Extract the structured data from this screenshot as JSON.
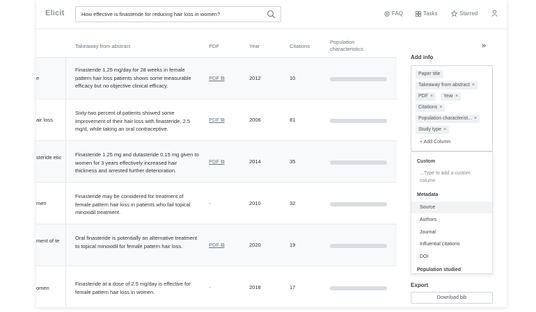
{
  "header": {
    "logo": "Elicit",
    "search_value": "How effective is finasteride for reducing hair loss in women?",
    "nav": {
      "faq": "FAQ",
      "tasks": "Tasks",
      "starred": "Starred"
    }
  },
  "table": {
    "columns": [
      "Takeaway from abstract",
      "PDF",
      "Year",
      "Citations",
      "Population",
      "characteristics"
    ],
    "rows": [
      {
        "left": "e",
        "takeaway": "Finasteride 1.25 mg/day for 28 weeks in female pattern hair loss patients shows some measurable efficacy but no objective clinical efficacy.",
        "pdf": "PDF",
        "year": "2012",
        "citations": "10"
      },
      {
        "left": "air loss.",
        "takeaway": "Sixty-two percent of patients showed some improvement of their hair loss with finasteride, 2.5 mg/d, while taking an oral contraceptive.",
        "pdf": "PDF",
        "year": "2006",
        "citations": "81"
      },
      {
        "left": "steride etic",
        "takeaway": "Finasteride 1.25 mg and dutasteride 0.15 mg given to women for 3 years effectively increased hair thickness and arrested further deterioration.",
        "pdf": "PDF",
        "year": "2014",
        "citations": "35"
      },
      {
        "left": "men",
        "takeaway": "Finasteride may be considered for treatment of female pattern hair loss in patients who fail topical minoxidil treatment.",
        "pdf": "-",
        "year": "2010",
        "citations": "32"
      },
      {
        "left": "ment of te",
        "takeaway": "Oral finasteride is potentially an alternative treatment to topical minoxidil for female pattern hair loss.",
        "pdf": "PDF",
        "year": "2020",
        "citations": "19"
      },
      {
        "left": "omen",
        "takeaway": "Finasteride at a dose of 2.5 mg/day is effective for female pattern hair loss in women.",
        "pdf": "-",
        "year": "2018",
        "citations": "17"
      }
    ]
  },
  "panel": {
    "collapse": "»",
    "add_info_title": "Add info",
    "chips": [
      "Paper title",
      "Takeaway from abstract",
      "PDF",
      "Year",
      "Citations",
      "Population characterist...",
      "Study type"
    ],
    "chip_remove": "×",
    "add_column": "+ Add Column",
    "dropdown": {
      "custom_header": "Custom",
      "custom_placeholder": "...Type to add a custom column",
      "metadata_header": "Metadata",
      "metadata_items": [
        "Source",
        "Authors",
        "Journal",
        "Influential citations",
        "DOI"
      ],
      "population_header": "Population studied"
    },
    "export_title": "Export",
    "download_bib": "Download bib"
  },
  "colors": {
    "accent": "#8a96a3",
    "bar": "#d9dde1",
    "row_shade": "#f8f9fa"
  }
}
